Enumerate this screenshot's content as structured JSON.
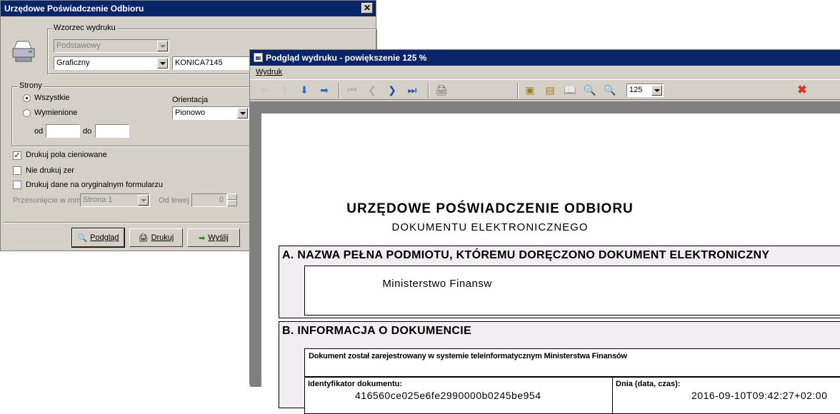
{
  "dialog1": {
    "title": "Urzędowe Poświadczenie Odbioru",
    "wzorzec": {
      "label": "Wzorzec  wydruku",
      "template_value": "Podstawowy",
      "mode_value": "Graficzny",
      "printer_value": "KONICA7145"
    },
    "strony": {
      "label": "Strony",
      "all_label": "Wszystkie",
      "listed_label": "Wymienione",
      "from_label": "od",
      "to_label": "do"
    },
    "orientacja": {
      "label": "Orientacja",
      "value": "Pionowo"
    },
    "options": {
      "shaded_label": "Drukuj pola cieniowane",
      "no_zeros_label": "Nie drukuj zer",
      "original_form_label": "Drukuj dane na oryginalnym formularzu"
    },
    "offset": {
      "label": "Przesunięcie w mm",
      "page_value": "Strona 1",
      "left_label": "Od lewej",
      "left_value": "0"
    },
    "buttons": {
      "preview": "Podgląd",
      "print": "Drukuj",
      "send": "Wyślij"
    }
  },
  "dialog2": {
    "title": "Podgląd wydruku - powiększenie 125 %",
    "menu": {
      "wydruk": "Wydruk"
    },
    "zoom_value": "125",
    "document": {
      "title1": "URZĘDOWE  POŚWIADCZENIE  ODBIORU",
      "title2": "DOKUMENTU  ELEKTRONICZNEGO",
      "section_a_head": "A. NAZWA PEŁNA PODMIOTU, KTÓREMU DORĘCZONO DOKUMENT ELEKTRONICZNY",
      "section_a_name": "Ministerstwo  Finansw",
      "section_b_head": "B. INFORMACJA O DOKUMENCIE",
      "section_b_text": "Dokument został zarejestrowany w systemie teleinformatycznym Ministerstwa Finansów",
      "id_label": "Identyfikator dokumentu:",
      "id_value": "416560ce025e6fe2990000b0245be954",
      "date_label": "Dnia (data, czas):",
      "date_value": "2016-09-10T09:42:27+02:00"
    }
  }
}
